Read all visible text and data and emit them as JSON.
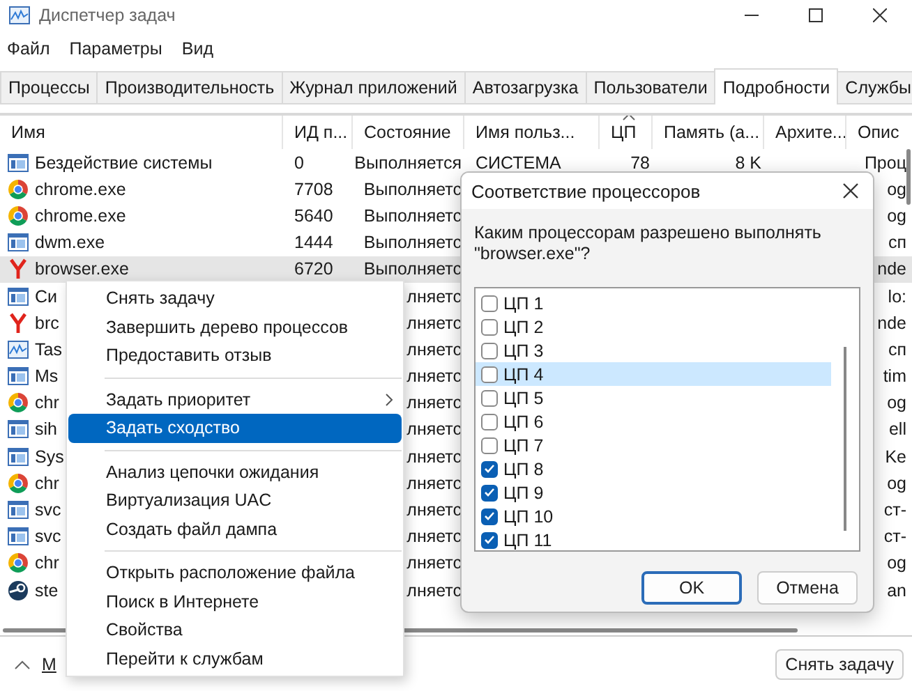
{
  "window": {
    "title": "Диспетчер задач"
  },
  "menu_bar": [
    "Файл",
    "Параметры",
    "Вид"
  ],
  "tabs": [
    {
      "label": "Процессы",
      "selected": false
    },
    {
      "label": "Производительность",
      "selected": false
    },
    {
      "label": "Журнал приложений",
      "selected": false
    },
    {
      "label": "Автозагрузка",
      "selected": false
    },
    {
      "label": "Пользователи",
      "selected": false
    },
    {
      "label": "Подробности",
      "selected": true
    },
    {
      "label": "Службы",
      "selected": false
    }
  ],
  "table": {
    "columns": [
      {
        "label": "Имя",
        "sorted": false
      },
      {
        "label": "ИД п...",
        "sorted": false
      },
      {
        "label": "Состояние",
        "sorted": false
      },
      {
        "label": "Имя польз...",
        "sorted": false
      },
      {
        "label": "ЦП",
        "sorted": true
      },
      {
        "label": "Память (а...",
        "sorted": false
      },
      {
        "label": "Архите...",
        "sorted": false
      },
      {
        "label": "Опис",
        "sorted": false
      }
    ],
    "rows": [
      {
        "kind": "window",
        "selected": false,
        "name": "Бездействие системы",
        "pid": "0",
        "state": "Выполняется",
        "user": "СИСТЕМА",
        "cpu": "78",
        "memory": "8 K",
        "description": "Проц"
      },
      {
        "kind": "chrome",
        "selected": false,
        "name": "chrome.exe",
        "pid": "7708",
        "state": "Выполняетс",
        "description": "og"
      },
      {
        "kind": "chrome",
        "selected": false,
        "name": "chrome.exe",
        "pid": "5640",
        "state": "Выполняетс",
        "description": "og"
      },
      {
        "kind": "window",
        "selected": false,
        "name": "dwm.exe",
        "pid": "1444",
        "state": "Выполняетс",
        "description": "сп"
      },
      {
        "kind": "y",
        "selected": true,
        "name": "browser.exe",
        "pid": "6720",
        "state": "Выполняетс",
        "description": "nde"
      },
      {
        "kind": "window",
        "selected": false,
        "name": "Си",
        "state": "лняетс",
        "description": "lo:"
      },
      {
        "kind": "y",
        "selected": false,
        "name": "brc",
        "state": "лняетс",
        "description": "nde"
      },
      {
        "kind": "chart",
        "selected": false,
        "name": "Tas",
        "state": "лняетс",
        "description": "сп"
      },
      {
        "kind": "window",
        "selected": false,
        "name": "Ms",
        "state": "лняетс",
        "description": "tim"
      },
      {
        "kind": "chrome",
        "selected": false,
        "name": "chr",
        "state": "лняетс",
        "description": "og"
      },
      {
        "kind": "window",
        "selected": false,
        "name": "sih",
        "state": "лняетс",
        "description": "ell"
      },
      {
        "kind": "window",
        "selected": false,
        "name": "Sys",
        "state": "лняетс",
        "description": "Ke"
      },
      {
        "kind": "chrome",
        "selected": false,
        "name": "chr",
        "state": "лняетс",
        "description": "og"
      },
      {
        "kind": "window",
        "selected": false,
        "name": "svc",
        "state": "лняетс",
        "description": "ст-"
      },
      {
        "kind": "window",
        "selected": false,
        "name": "svc",
        "state": "лняетс",
        "description": "ст-"
      },
      {
        "kind": "chrome",
        "selected": false,
        "name": "chr",
        "state": "лняетс",
        "description": "og"
      },
      {
        "kind": "steam",
        "selected": false,
        "name": "ste",
        "state": "лняетс",
        "description": "an"
      }
    ]
  },
  "footer": {
    "link": "М",
    "button": "Снять задачу"
  },
  "context_menu": [
    {
      "kind": "item",
      "label": "Снять задачу",
      "selected": false,
      "submenu": false
    },
    {
      "kind": "item",
      "label": "Завершить дерево процессов",
      "selected": false,
      "submenu": false
    },
    {
      "kind": "item",
      "label": "Предоставить отзыв",
      "selected": false,
      "submenu": false
    },
    {
      "kind": "separator"
    },
    {
      "kind": "item",
      "label": "Задать приоритет",
      "selected": false,
      "submenu": true
    },
    {
      "kind": "item",
      "label": "Задать сходство",
      "selected": true,
      "submenu": false
    },
    {
      "kind": "separator"
    },
    {
      "kind": "item",
      "label": "Анализ цепочки ожидания",
      "selected": false,
      "submenu": false
    },
    {
      "kind": "item",
      "label": "Виртуализация UAC",
      "selected": false,
      "submenu": false
    },
    {
      "kind": "item",
      "label": "Создать файл дампа",
      "selected": false,
      "submenu": false
    },
    {
      "kind": "separator"
    },
    {
      "kind": "item",
      "label": "Открыть расположение файла",
      "selected": false,
      "submenu": false
    },
    {
      "kind": "item",
      "label": "Поиск в Интернете",
      "selected": false,
      "submenu": false
    },
    {
      "kind": "item",
      "label": "Свойства",
      "selected": false,
      "submenu": false
    },
    {
      "kind": "item",
      "label": "Перейти к службам",
      "selected": false,
      "submenu": false
    }
  ],
  "dialog": {
    "title": "Соответствие процессоров",
    "prompt": "Каким процессорам разрешено выполнять \"browser.exe\"?",
    "options": [
      {
        "label": "ЦП 1",
        "checked": false,
        "selected": false
      },
      {
        "label": "ЦП 2",
        "checked": false,
        "selected": false
      },
      {
        "label": "ЦП 3",
        "checked": false,
        "selected": false
      },
      {
        "label": "ЦП 4",
        "checked": false,
        "selected": true
      },
      {
        "label": "ЦП 5",
        "checked": false,
        "selected": false
      },
      {
        "label": "ЦП 6",
        "checked": false,
        "selected": false
      },
      {
        "label": "ЦП 7",
        "checked": false,
        "selected": false
      },
      {
        "label": "ЦП 8",
        "checked": true,
        "selected": false
      },
      {
        "label": "ЦП 9",
        "checked": true,
        "selected": false
      },
      {
        "label": "ЦП 10",
        "checked": true,
        "selected": false
      },
      {
        "label": "ЦП 11",
        "checked": true,
        "selected": false
      }
    ],
    "buttons": [
      {
        "label": "OK",
        "default": true
      },
      {
        "label": "Отмена",
        "default": false
      }
    ]
  }
}
